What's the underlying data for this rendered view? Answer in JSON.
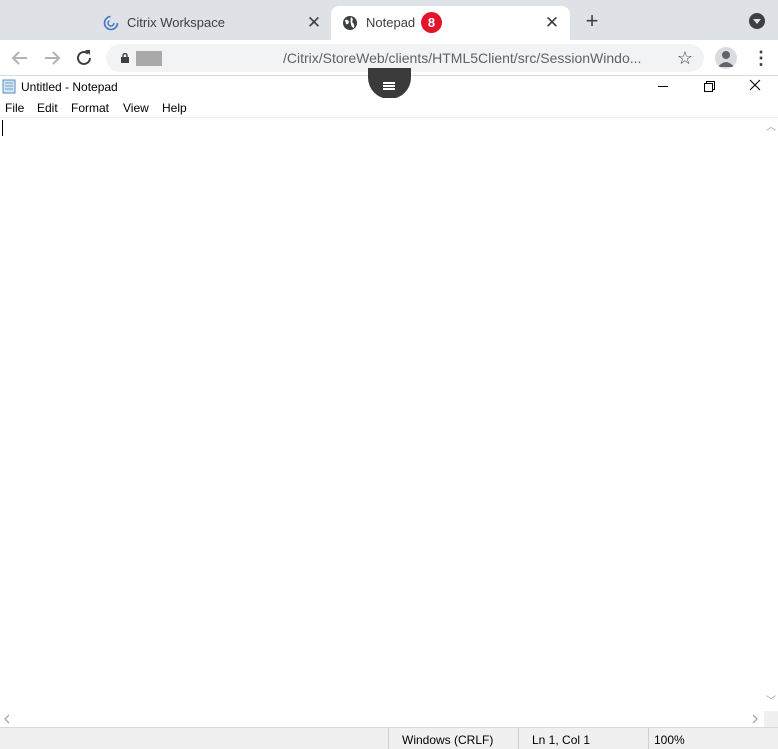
{
  "browser": {
    "tabs": [
      {
        "title": "Citrix Workspace",
        "icon": "citrix-logo-icon",
        "active": false
      },
      {
        "title": "Notepad",
        "icon": "globe-icon",
        "active": true,
        "badge": "8"
      }
    ],
    "address_bar": {
      "url": "/Citrix/StoreWeb/clients/HTML5Client/src/SessionWindo..."
    }
  },
  "notepad": {
    "window_title": "Untitled - Notepad",
    "menu": [
      "File",
      "Edit",
      "Format",
      "View",
      "Help"
    ],
    "content": "",
    "status": {
      "line_ending": "Windows (CRLF)",
      "position": "Ln 1, Col 1",
      "zoom": "100%"
    }
  },
  "colors": {
    "tabstrip_bg": "#dee1e6",
    "badge_red": "#e2132b",
    "citrix_blue": "#4472c4",
    "statusbar_bg": "#f0f0f0"
  }
}
